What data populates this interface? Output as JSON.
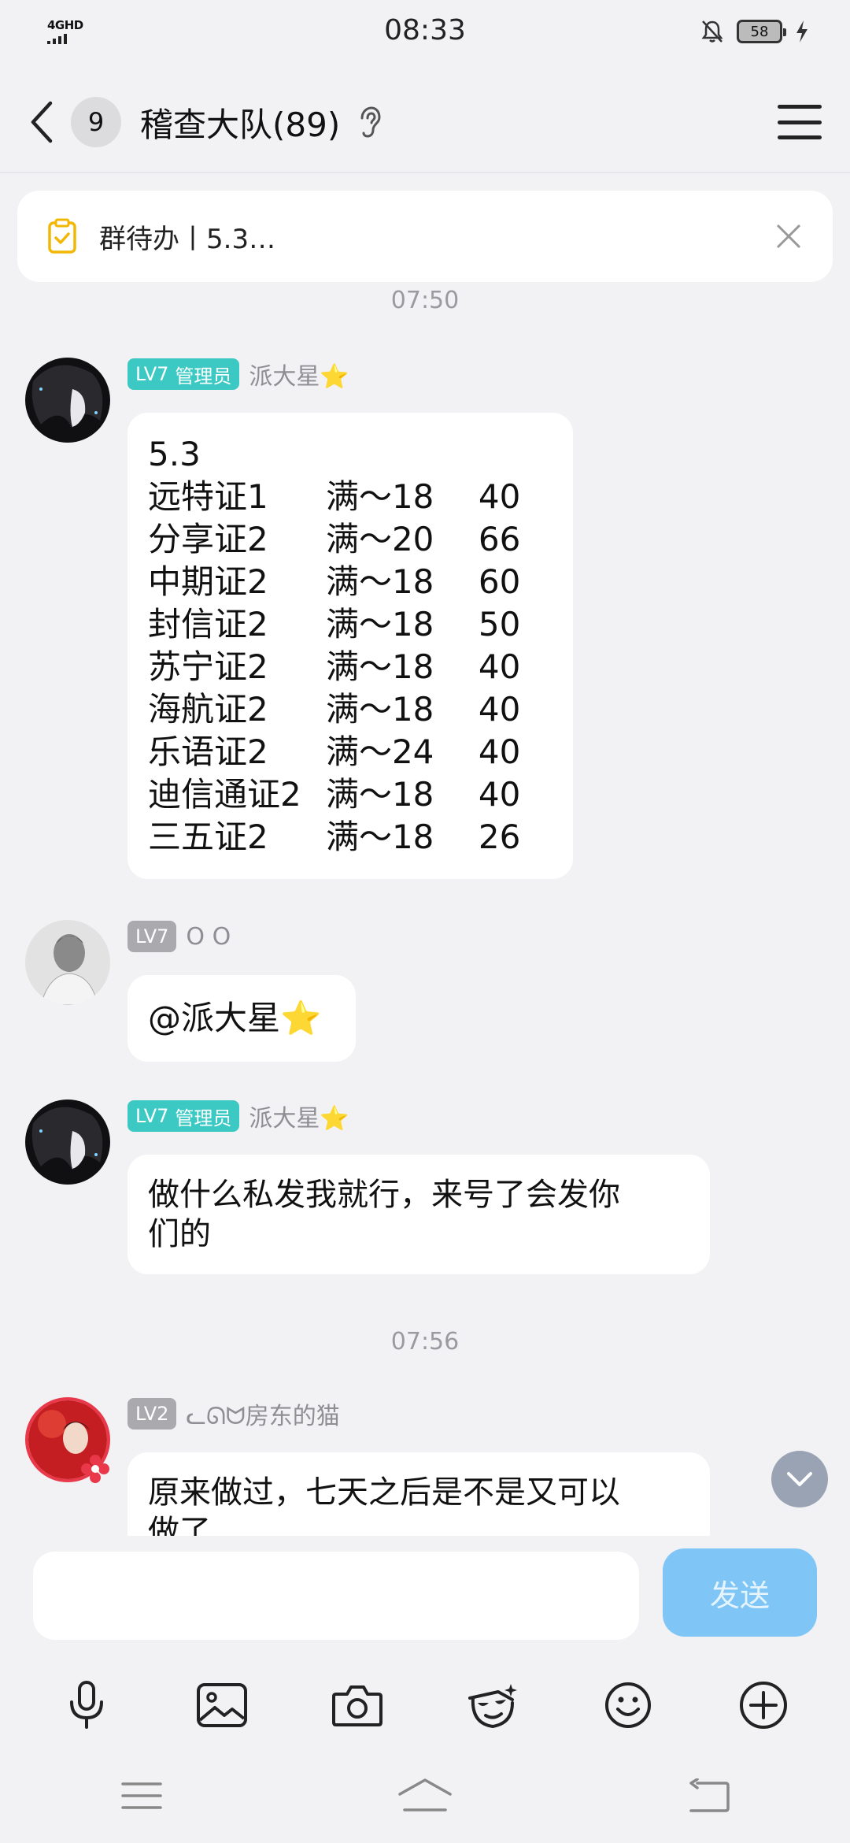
{
  "status_bar": {
    "network": "4GHD",
    "time": "08:33",
    "battery": "58"
  },
  "header": {
    "unread_count": "9",
    "title": "稽查大队(89)"
  },
  "pinned_todo": {
    "text": "群待办丨5.3…"
  },
  "timestamps": [
    "07:50",
    "07:56"
  ],
  "messages": [
    {
      "level": "LV7",
      "role": "管理员",
      "sender": "派大星⭐",
      "title_line": "5.3",
      "rows": [
        [
          "远特证1",
          "满～18",
          "40"
        ],
        [
          "分享证2",
          "满～20",
          "66"
        ],
        [
          "中期证2",
          "满～18",
          "60"
        ],
        [
          "封信证2",
          "满～18",
          "50"
        ],
        [
          "苏宁证2",
          "满～18",
          "40"
        ],
        [
          "海航证2",
          "满～18",
          "40"
        ],
        [
          "乐语证2",
          "满～24",
          "40"
        ],
        [
          "迪信通证2",
          "满～18",
          "40"
        ],
        [
          "三五证2",
          "满～18",
          "26"
        ]
      ]
    },
    {
      "level": "LV7",
      "sender": "O O",
      "text": "@派大星⭐"
    },
    {
      "level": "LV7",
      "role": "管理员",
      "sender": "派大星⭐",
      "text_line1": "做什么私发我就行，来号了会发你",
      "text_line2": "们的"
    },
    {
      "level": "LV2",
      "sender": "ᓚᘏᗢ房东的猫",
      "text_line1": "原来做过，七天之后是不是又可以",
      "text_line2": "做了"
    }
  ],
  "input": {
    "send_label": "发送"
  },
  "colors": {
    "admin_badge": "#3cc9c4",
    "level_badge": "#a9a9ae",
    "send_button": "#7fc6f7",
    "background": "#f2f2f5"
  },
  "icons": [
    "back-icon",
    "hearing-icon",
    "menu-icon",
    "todo-icon",
    "close-icon",
    "mic-icon",
    "image-icon",
    "camera-icon",
    "sticker-icon",
    "emoji-icon",
    "plus-icon"
  ]
}
